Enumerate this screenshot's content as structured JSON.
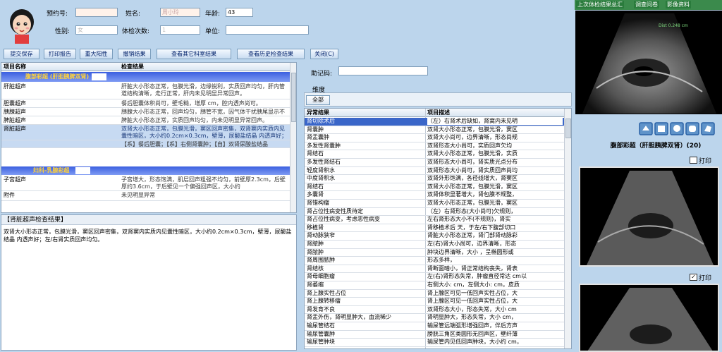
{
  "patient": {
    "appt_label": "预约号:",
    "appt_value": "",
    "name_label": "姓名:",
    "name_value": "周小玲",
    "age_label": "年龄:",
    "age_value": "43",
    "sex_label": "性别:",
    "sex_value": "女",
    "visits_label": "体检次数:",
    "visits_value": "1",
    "unit_label": "单位:",
    "unit_value": ""
  },
  "toolbar": {
    "submit": "提交保存",
    "print": "打印报告",
    "positive": "重大阳性",
    "cancel": "撤销结果",
    "other_results": "查看其它科室结果",
    "history": "查看历史检查结果",
    "close": "关闭(C)"
  },
  "results_table": {
    "col_name": "项目名称",
    "col_result": "检查结果",
    "group1": "腹部彩超 (肝胆胰脾双肾)",
    "group2": "妇科-乳腺彩超",
    "rows": [
      {
        "name": "肝脏超声",
        "result": "肝脏大小形态正常，包膜光滑，边缘锐利，实质回声均匀，肝内管道结构清晰，走行正常，肝内未见明显异常回声。"
      },
      {
        "name": "胆囊超声",
        "result": "餐后胆囊体积尚可，壁毛糙，增厚 cm，腔内透声尚可。"
      },
      {
        "name": "胰腺超声",
        "result": "胰腺大小形态正常，回声均匀，胰管不宽，因气体干扰胰尾显示不清。"
      },
      {
        "name": "脾脏超声",
        "result": "脾脏大小形态正常，实质回声均匀，内未见明显异常回声。"
      },
      {
        "name": "肾脏超声",
        "result": "双肾大小形态正常，包膜光滑，窦区回声密集，双肾窦内实质内见囊性暗区，大小约0.2cm×0.3cm，壁薄，尿酸盐结晶 内透声好；左/右肾实质回声均匀。"
      },
      {
        "name": "",
        "result": "【系】餐后胆囊；【系】右侧肾囊肿；【自】双肾尿酸盐结晶"
      },
      {
        "name": "子宫超声",
        "result": "子宫增大，形态饱满，肌层回声粗强不均匀，前壁厚2.3cm，后壁厚约3.6cm，于后壁见一个偏强回声区，大小约 5.5cm×5.0cm×4.8cm ，边界欠清晰，形态尚规整，CDFI:其内及周边可见血流信号。CDFI:可见血流信号，内膜显示欠清晰，厚约0.8cm，宫颈回声尚可。CDFI:未见明显异常血流信号。"
      },
      {
        "name": "附件",
        "result": "未见明显异常"
      }
    ]
  },
  "kidney_summary": {
    "title": "【肾脏超声检查结果】",
    "text": "双肾大小形态正常，包膜光滑，窦区回声密集，双肾窦内实质内见囊性暗区，大小约0.2cm×0.3cm，壁薄，尿酸盐结晶 内透声好；左/右肾实质回声均匀。"
  },
  "middle": {
    "mnemonic_label": "助记码:",
    "mnemonic_value": "",
    "dimension_label": "维度",
    "all_button": "全部",
    "col_abnormal": "异常结果",
    "col_desc": "项目描述",
    "rows": [
      {
        "a": "肾切除术后",
        "d": "（左）右肾术后缺如，肾窝内未见明"
      },
      {
        "a": "肾囊肿",
        "d": "双肾大小形态正常，包膜光滑，窦区"
      },
      {
        "a": "肾盂囊肿",
        "d": "双肾大小尚可，边界清晰，形态尚规"
      },
      {
        "a": "多发性肾囊肿",
        "d": "双肾形态大小尚可，实质回声欠均"
      },
      {
        "a": "肾结石",
        "d": "双肾大小形态正常，包膜光滑，实质"
      },
      {
        "a": "多发性肾结石",
        "d": "双肾形态大小尚可，肾实质光点分布"
      },
      {
        "a": "轻度肾积水",
        "d": "双肾形态大小尚可，肾实质回声尚均"
      },
      {
        "a": "中度肾积水",
        "d": "双肾外形饱满，各径线增大，肾窦区"
      },
      {
        "a": "肾结石",
        "d": "双肾大小形态正常，包膜光滑，窦区"
      },
      {
        "a": "多囊肾",
        "d": "双肾体积显著增大，肾包膜不规整，"
      },
      {
        "a": "肾错构瘤",
        "d": "双肾大小形态正常，包膜光滑，窦区"
      },
      {
        "a": "肾占位性病变性质待定",
        "d": "（左）右肾形态(大小尚可)欠规则，"
      },
      {
        "a": "肾占位性病变，考虑恶性病变",
        "d": "左右肾形态大小不(不规则)，肾实"
      },
      {
        "a": "移植肾",
        "d": "肾移植术后 天，于左/右下腹部切口"
      },
      {
        "a": "肾动脉狭窄",
        "d": "肾脏大小形态正常，肾门部肾动脉彩"
      },
      {
        "a": "肾脓肿",
        "d": "左(右)肾大小尚可，边界清晰，形态"
      },
      {
        "a": "肾脓肿",
        "d": "肿块边界清晰，大小 ，呈椭圆形或"
      },
      {
        "a": "肾周围脓肿",
        "d": "形态多样，"
      },
      {
        "a": "肾结核",
        "d": "肾断面暗小，肾正常结构丧失，肾表"
      },
      {
        "a": "肾母细胞瘤",
        "d": "左(右)肾形态失常，肿瘤直径常达 cm以"
      },
      {
        "a": "肾萎缩",
        "d": "右侧大小: cm，左侧大小: cm，皮质"
      },
      {
        "a": "肾上腺实性占位",
        "d": "肾上腺区可见一低回声实性占位，大"
      },
      {
        "a": "肾上腺转移瘤",
        "d": "肾上腺区可见一低回声实性占位，大"
      },
      {
        "a": "肾发育不良",
        "d": "双肾形态大小，形态失常，大小 cm"
      },
      {
        "a": "肾盂外伤，肾明显肿大，血流稀少",
        "d": "肾明显肿大，形态失常，大小 cm，"
      },
      {
        "a": "输尿管结石",
        "d": "输尿管远端弧形增强回声，伴后方声"
      },
      {
        "a": "输尿管囊肿",
        "d": "膀胱三角区类圆形无回声区，壁纤薄"
      },
      {
        "a": "输尿管肿块",
        "d": "输尿管内见低回声肿块，大小约 cm，"
      }
    ]
  },
  "right": {
    "tab1": "上次体检结果总汇",
    "tab2": "调查问卷",
    "tab3": "影像资料",
    "image_title": "腹部彩超（肝胆胰脾双肾）(20)",
    "print1": "打印",
    "print2": "打印",
    "us_freq": "Dist 0.248 cm"
  }
}
